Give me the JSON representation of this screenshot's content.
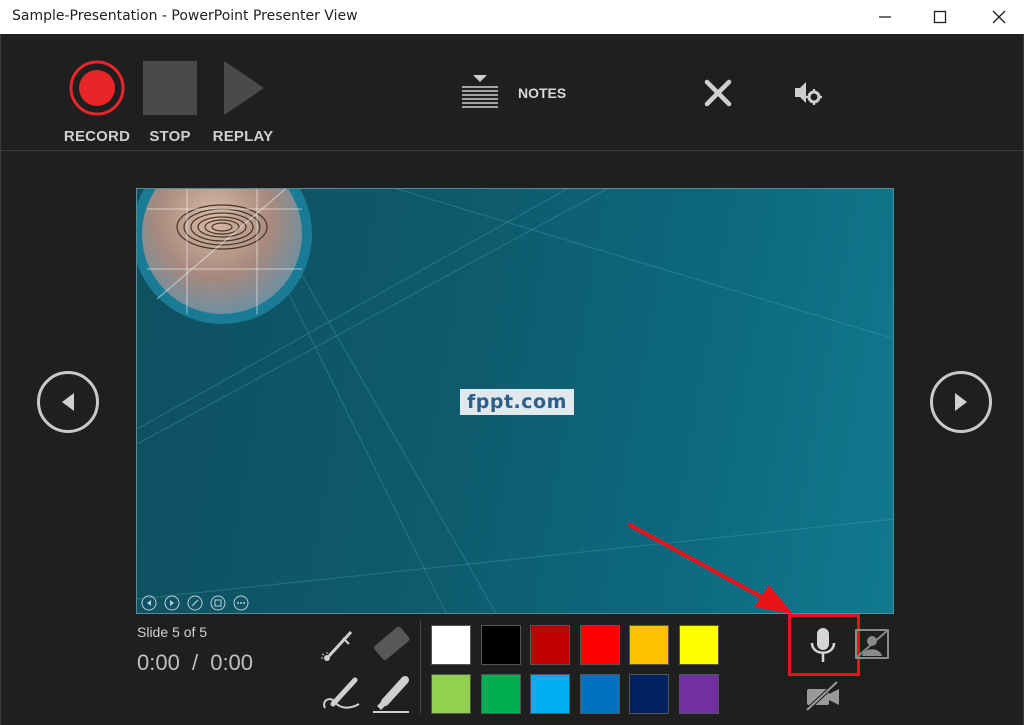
{
  "window": {
    "title": "Sample-Presentation - PowerPoint Presenter View"
  },
  "toolbar": {
    "record_label": "RECORD",
    "stop_label": "STOP",
    "replay_label": "REPLAY",
    "notes_label": "NOTES"
  },
  "slide": {
    "logo_text": "fppt.com"
  },
  "status": {
    "slide_counter": "Slide 5 of 5",
    "time_elapsed": "0:00",
    "time_separator": "/",
    "time_total": "0:00"
  },
  "colors": {
    "accent_record": "#e8262a",
    "annotation_highlight": "#e8141a",
    "palette_row1": [
      "#ffffff",
      "#000000",
      "#c00000",
      "#ff0000",
      "#ffc000",
      "#ffff00"
    ],
    "palette_row2": [
      "#92d050",
      "#00b050",
      "#00b0f0",
      "#0070c0",
      "#002060",
      "#7030a0"
    ]
  },
  "icons": [
    "record-icon",
    "stop-icon",
    "replay-icon",
    "notes-icon",
    "close-icon",
    "audio-settings-icon",
    "previous-slide-icon",
    "next-slide-icon",
    "laser-pointer-icon",
    "eraser-icon",
    "pen-icon",
    "highlighter-icon",
    "microphone-icon",
    "camera-off-icon",
    "camera-preview-off-icon"
  ]
}
